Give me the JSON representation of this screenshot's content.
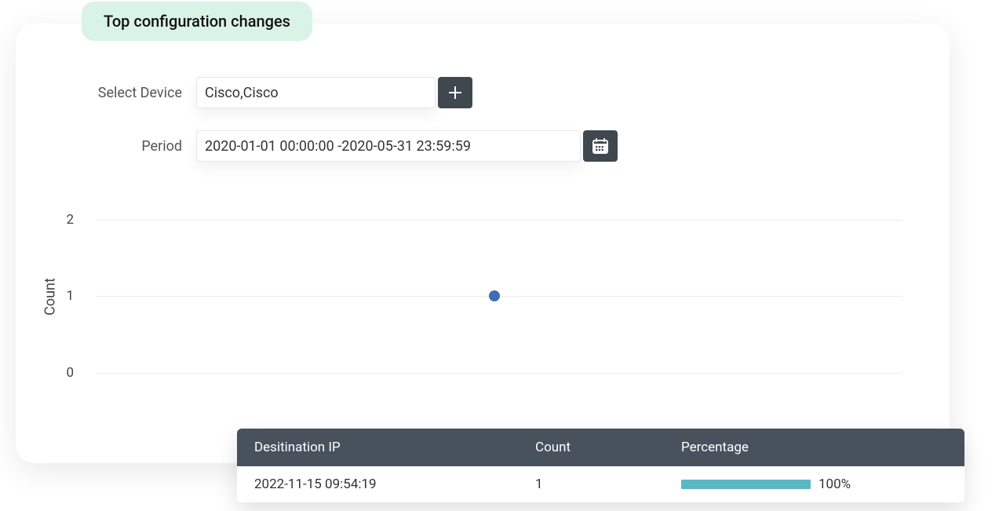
{
  "header": {
    "title": "Top configuration changes"
  },
  "filters": {
    "device": {
      "label": "Select Device",
      "value": "Cisco,Cisco"
    },
    "period": {
      "label": "Period",
      "value": "2020-01-01 00:00:00 -2020-05-31 23:59:59"
    }
  },
  "chart_data": {
    "type": "scatter",
    "ylabel": "Count",
    "ylim": [
      0,
      2
    ],
    "yticks": [
      0,
      1,
      2
    ],
    "series": [
      {
        "name": "count",
        "values": [
          1
        ]
      }
    ]
  },
  "table": {
    "headers": {
      "col0": "Desitination IP",
      "col1": "Count",
      "col2": "Percentage"
    },
    "rows": [
      {
        "col0": "2022-11-15 09:54:19",
        "col1": "1",
        "pct_label": "100%",
        "pct_value": 100
      }
    ]
  }
}
